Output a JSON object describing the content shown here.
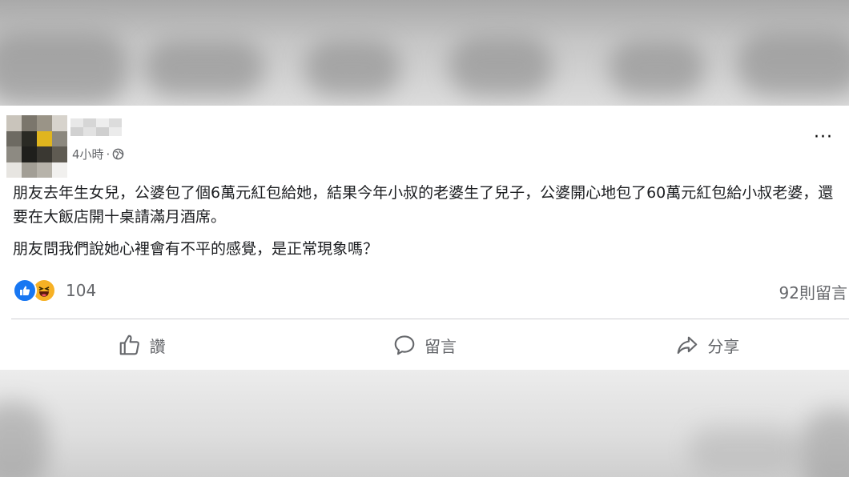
{
  "post": {
    "timestamp": "4小時",
    "separator": "·",
    "more_label": "···",
    "paragraphs": [
      "朋友去年生女兒，公婆包了個6萬元紅包給她，結果今年小叔的老婆生了兒子，公婆開心地包了60萬元紅包給小叔老婆，還要在大飯店開十桌請滿月酒席。",
      "朋友問我們說她心裡會有不平的感覺，是正常現象嗎？"
    ],
    "reactions": {
      "icons": [
        "like-icon",
        "haha-icon"
      ],
      "count": "104"
    },
    "comments_count": "92則留言",
    "actions": {
      "like_label": "讚",
      "comment_label": "留言",
      "share_label": "分享"
    }
  },
  "colors": {
    "facebook_blue": "#1877f2",
    "haha_yellow": "#f7b125",
    "secondary_text": "#65676b",
    "primary_text": "#1c1e21"
  }
}
